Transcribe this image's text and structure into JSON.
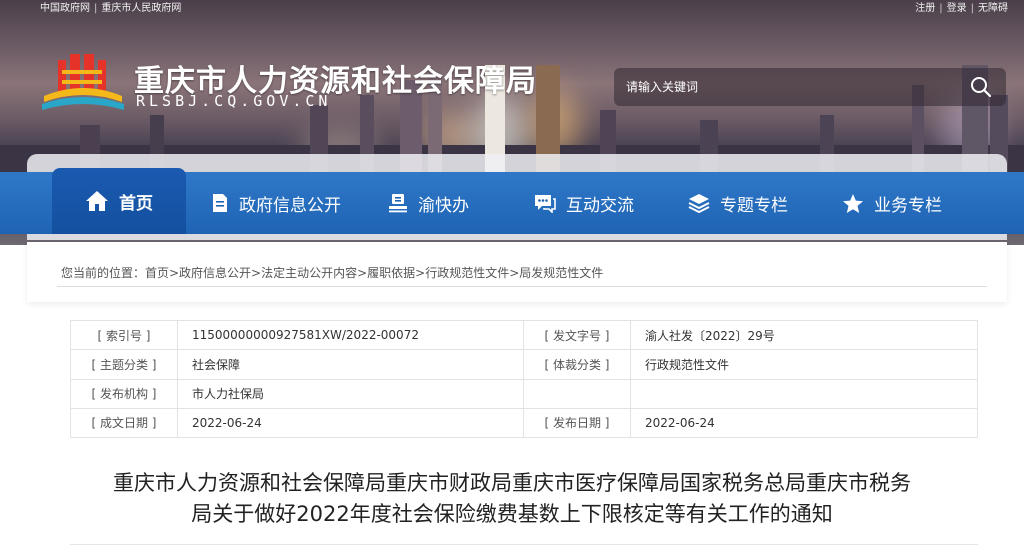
{
  "topbar": {
    "left_links": [
      "中国政府网",
      "重庆市人民政府网"
    ],
    "right_links": [
      "注册",
      "登录",
      "无障碍"
    ]
  },
  "header": {
    "title": "重庆市人力资源和社会保障局",
    "domain": "RLSBJ.CQ.GOV.CN"
  },
  "search": {
    "placeholder": "请输入关键词",
    "icon": "search-icon"
  },
  "nav": {
    "items": [
      {
        "label": "首页",
        "icon": "home-icon"
      },
      {
        "label": "政府信息公开",
        "icon": "document-icon"
      },
      {
        "label": "渝快办",
        "icon": "stamp-icon"
      },
      {
        "label": "互动交流",
        "icon": "chat-icon"
      },
      {
        "label": "专题专栏",
        "icon": "layers-icon"
      },
      {
        "label": "业务专栏",
        "icon": "star-icon"
      }
    ],
    "active_color": "#14509f",
    "bar_color": "#1f63b4"
  },
  "breadcrumb": "您当前的位置：首页>政府信息公开>法定主动公开内容>履职依据>行政规范性文件>局发规范性文件",
  "info": {
    "index_label": "[ 索引号 ]",
    "index_value": "11500000000927581XW/2022-00072",
    "docno_label": "[ 发文字号 ]",
    "docno_value": "渝人社发〔2022〕29号",
    "topic_label": "[ 主题分类 ]",
    "topic_value": "社会保障",
    "genre_label": "[ 体裁分类 ]",
    "genre_value": "行政规范性文件",
    "publisher_label": "[ 发布机构 ]",
    "publisher_value": "市人力社保局",
    "created_label": "[ 成文日期 ]",
    "created_value": "2022-06-24",
    "published_label": "[ 发布日期 ]",
    "published_value": "2022-06-24"
  },
  "document": {
    "title_line1": "重庆市人力资源和社会保障局重庆市财政局重庆市医疗保障局国家税务总局重庆市税务",
    "title_line2": "局关于做好2022年度社会保险缴费基数上下限核定等有关工作的通知"
  }
}
